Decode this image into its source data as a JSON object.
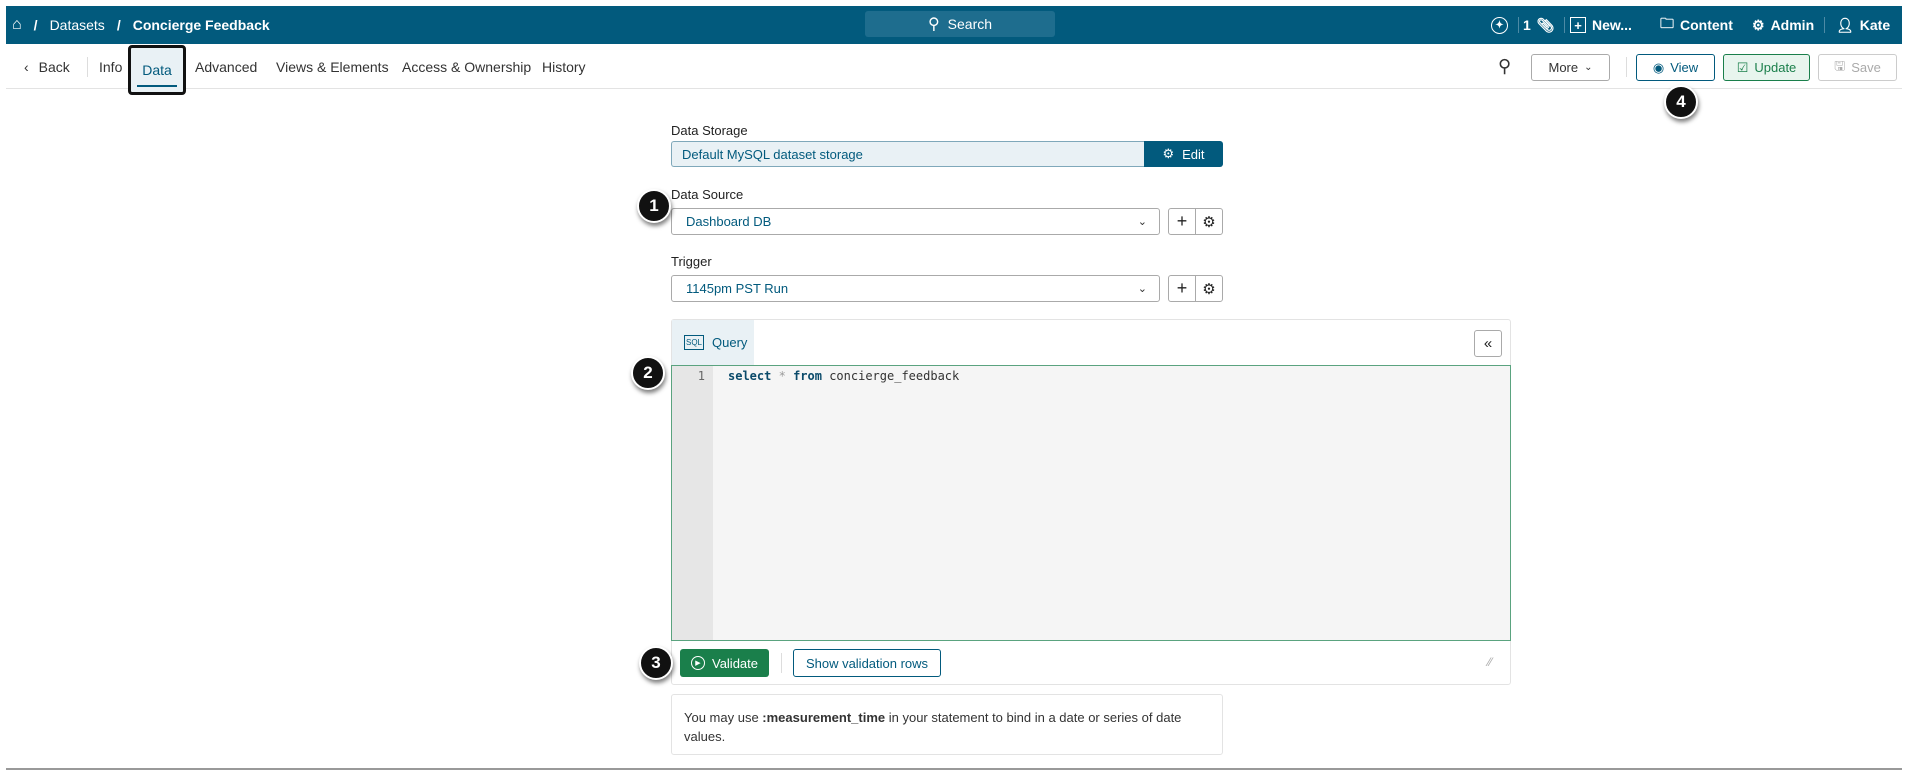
{
  "topbar": {
    "breadcrumb": [
      "Datasets",
      "Concierge Feedback"
    ],
    "search": "Search",
    "count": "1",
    "new": "New...",
    "content": "Content",
    "admin": "Admin",
    "user": "Kate"
  },
  "tabs": {
    "back": "Back",
    "items": [
      "Info",
      "Data",
      "Advanced",
      "Views & Elements",
      "Access & Ownership",
      "History"
    ],
    "active": "Data"
  },
  "actions": {
    "more": "More",
    "view": "View",
    "update": "Update",
    "save": "Save"
  },
  "form": {
    "storage_label": "Data Storage",
    "storage_value": "Default MySQL dataset storage",
    "edit": "Edit",
    "source_label": "Data Source",
    "source_value": "Dashboard DB",
    "trigger_label": "Trigger",
    "trigger_value": "1145pm PST Run"
  },
  "query": {
    "tab": "Query",
    "line": "1",
    "kw1": "select",
    "op": "*",
    "kw2": "from",
    "table": "concierge_feedback",
    "collapse": "«",
    "validate": "Validate",
    "show_rows": "Show validation rows"
  },
  "info": {
    "pre": "You may use ",
    "bold": ":measurement_time",
    "post": " in your statement to bind in a date or series of date values."
  },
  "badges": [
    "1",
    "2",
    "3",
    "4"
  ],
  "colors": {
    "brand": "#025a7d",
    "green": "#1a7f4b"
  }
}
